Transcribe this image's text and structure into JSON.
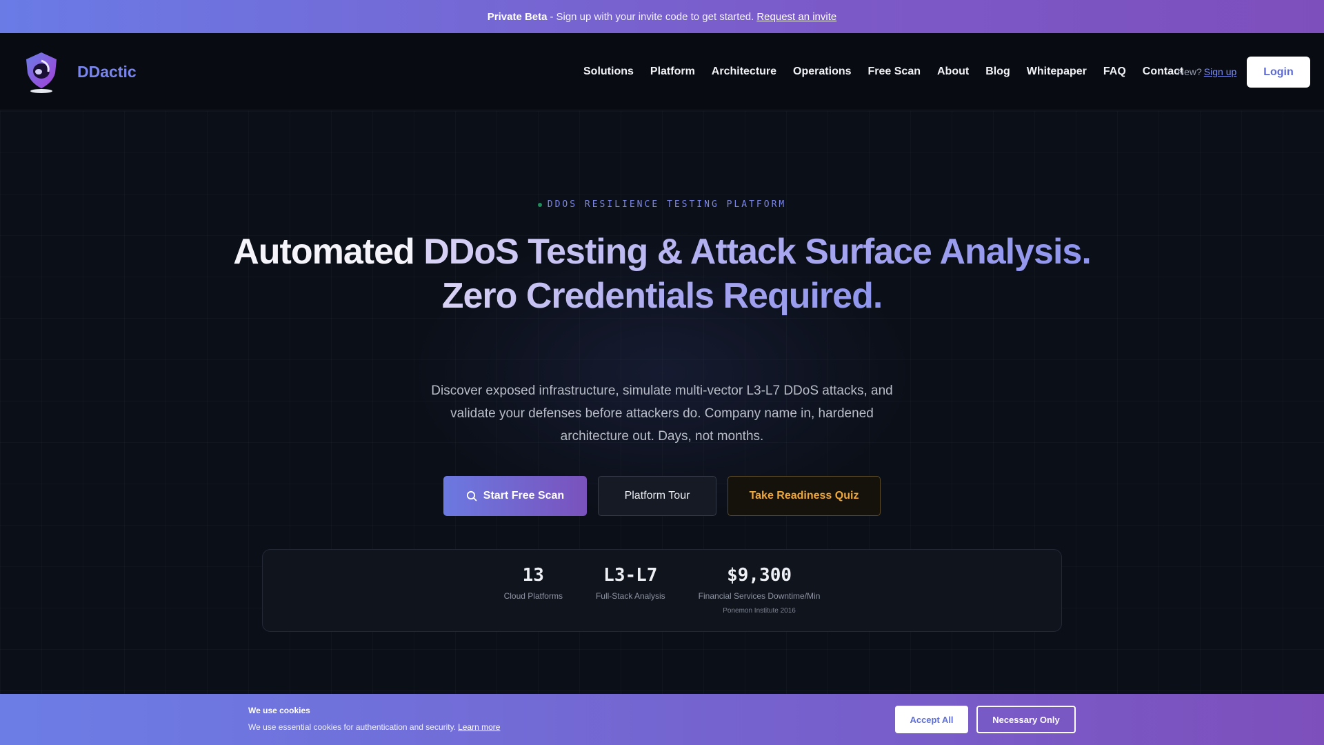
{
  "banner": {
    "bold": "Private Beta",
    "separator": "-",
    "text": "Sign up with your invite code to get started.",
    "link": "Request an invite"
  },
  "nav": {
    "brand": "DDactic",
    "logo_icon": "shield-logo-icon",
    "links": [
      "Solutions",
      "Platform",
      "Architecture",
      "Operations",
      "Free Scan",
      "About",
      "Blog",
      "Whitepaper",
      "FAQ",
      "Contact"
    ],
    "new_text": "New?",
    "signup_link": "Sign up",
    "login": "Login"
  },
  "hero": {
    "eyebrow": "DDOS RESILIENCE TESTING PLATFORM",
    "headline_part1": "Automated ",
    "headline_part2": "DDoS Testing & Attack Surface Analysis.",
    "headline_line2": "Zero Credentials Required.",
    "subtitle": "Discover exposed infrastructure, simulate multi-vector L3-L7 DDoS attacks, and validate your defenses before attackers do. Company name in, hardened architecture out. Days, not months.",
    "buttons": {
      "primary": "Start Free Scan",
      "primary_icon": "search-icon",
      "secondary": "Platform Tour",
      "tertiary": "Take Readiness Quiz"
    }
  },
  "stats": [
    {
      "value": "13",
      "label": "Cloud Platforms"
    },
    {
      "value": "L3-L7",
      "label": "Full-Stack Analysis"
    },
    {
      "value": "$9,300",
      "label": "Financial Services Downtime/Min",
      "note": "Ponemon Institute 2016"
    }
  ],
  "cookie": {
    "title": "We use cookies",
    "text": "We use essential cookies for authentication and security.",
    "link": "Learn more",
    "accept": "Accept All",
    "necessary": "Necessary Only"
  },
  "colors": {
    "accent": "#6b79e0",
    "accent_purple": "#7a52bd",
    "amber": "#f0a83a",
    "background": "#0a0e17"
  }
}
